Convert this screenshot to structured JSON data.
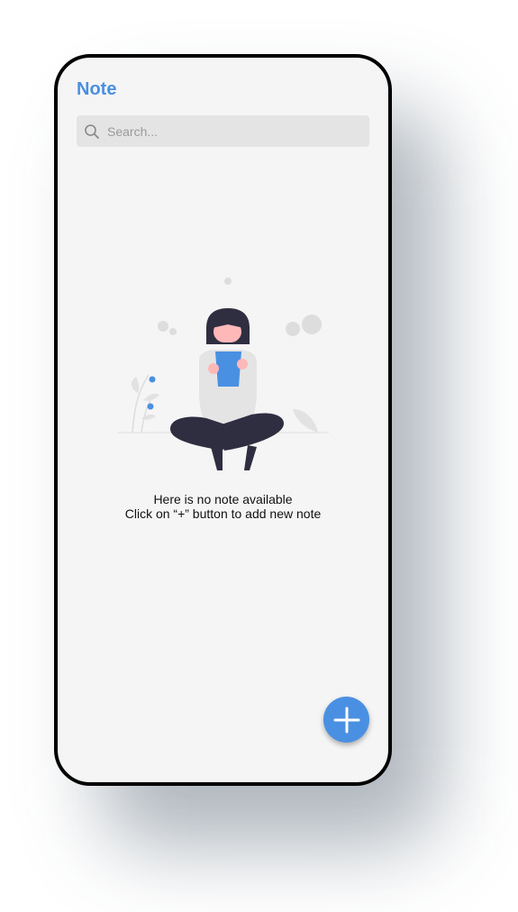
{
  "app": {
    "title": "Note",
    "accent_color": "#4a90e2"
  },
  "search": {
    "placeholder": "Search...",
    "value": ""
  },
  "empty_state": {
    "illustration": "person-reading-illustration",
    "line1": "Here is no note available",
    "line2": "Click on “+” button to add new note"
  },
  "fab": {
    "icon": "plus-icon"
  }
}
